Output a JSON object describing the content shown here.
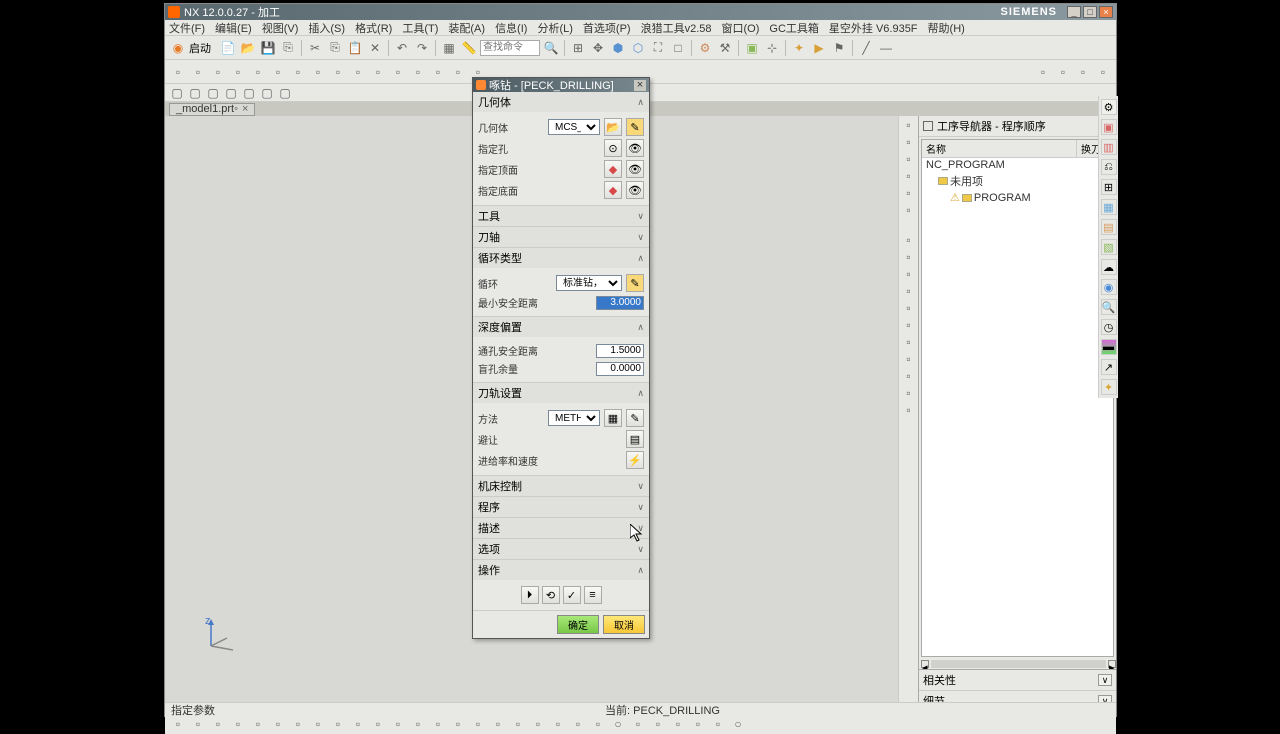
{
  "title": "NX 12.0.0.27 - 加工",
  "brand": "SIEMENS",
  "menu": {
    "file": "文件(F)",
    "edit": "编辑(E)",
    "view": "视图(V)",
    "insert": "插入(S)",
    "format": "格式(R)",
    "tools": "工具(T)",
    "assemblies": "装配(A)",
    "info": "信息(I)",
    "analysis": "分析(L)",
    "preferences": "首选项(P)",
    "ext": "浪猎工具v2.58",
    "window": "窗口(O)",
    "gc": "GC工具箱",
    "star": "星空外挂 V6.935F",
    "help": "帮助(H)"
  },
  "start_label": "启动",
  "search_placeholder": "查找命令",
  "tab_name": "_model1.prt",
  "nav": {
    "title": "工序导航器 - 程序顺序",
    "col_name": "名称",
    "col_tool": "换刀",
    "root": "NC_PROGRAM",
    "unused": "未用项",
    "program": "PROGRAM"
  },
  "prop": {
    "rel": "相关性",
    "detail": "细节"
  },
  "dialog": {
    "title": "啄钻 - [PECK_DRILLING]",
    "geom_hdr": "几何体",
    "geom_lbl": "几何体",
    "geom_val": "MCS_MILL",
    "spec_hole": "指定孔",
    "spec_top": "指定顶面",
    "spec_bot": "指定底面",
    "tool_hdr": "工具",
    "axis_hdr": "刀轴",
    "cycle_hdr": "循环类型",
    "cycle_lbl": "循环",
    "cycle_val": "标准钻，深孔...",
    "min_clear": "最小安全距离",
    "min_clear_val": "3.0000",
    "depth_hdr": "深度偏置",
    "thru_clear": "通孔安全距离",
    "thru_val": "1.5000",
    "blind": "盲孔余量",
    "blind_val": "0.0000",
    "path_hdr": "刀轨设置",
    "method_lbl": "方法",
    "method_val": "METHOD",
    "avoid": "避让",
    "feed": "进给率和速度",
    "mc_hdr": "机床控制",
    "prog_hdr": "程序",
    "desc_hdr": "描述",
    "opt_hdr": "选项",
    "act_hdr": "操作",
    "ok": "确定",
    "cancel": "取消"
  },
  "status": {
    "left": "指定参数",
    "mid": "当前: PECK_DRILLING"
  }
}
